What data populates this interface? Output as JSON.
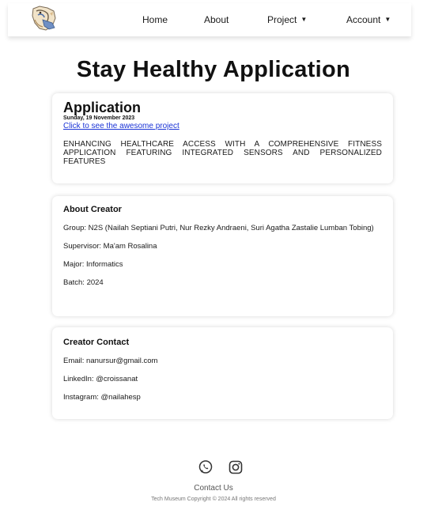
{
  "navbar": {
    "logo_icon": "mascot-logo-icon",
    "links": [
      {
        "label": "Home"
      },
      {
        "label": "About"
      },
      {
        "label": "Project",
        "has_dropdown": true
      },
      {
        "label": "Account",
        "has_dropdown": true
      }
    ]
  },
  "page": {
    "title": "Stay Healthy Application"
  },
  "application": {
    "title": "Application",
    "date": "Sunday, 19 November 2023",
    "link_text": "Click to see the awesome project",
    "description": "ENHANCING HEALTHCARE ACCESS WITH A COMPREHENSIVE FITNESS APPLICATION FEATURING INTEGRATED SENSORS AND PERSONALIZED FEATURES"
  },
  "creator": {
    "heading": "About Creator",
    "group": "Group: N2S (Nailah Septiani Putri, Nur Rezky Andraeni, Suri Agatha Zastalie Lumban Tobing)",
    "supervisor": "Supervisor: Ma'am Rosalina",
    "major": "Major: Informatics",
    "batch": "Batch: 2024"
  },
  "contact": {
    "heading": "Creator Contact",
    "email": "Email: nanursur@gmail.com",
    "linkedin": "LinkedIn: @croissanat",
    "instagram": "Instagram: @nailahesp"
  },
  "footer": {
    "social_icons": [
      "whatsapp-icon",
      "instagram-icon"
    ],
    "contact_us": "Contact Us",
    "copyright": "Tech Museum Copyright © 2024 All rights reserved"
  },
  "colors": {
    "link": "#1a33d6",
    "text": "#111111",
    "background": "#ffffff"
  }
}
